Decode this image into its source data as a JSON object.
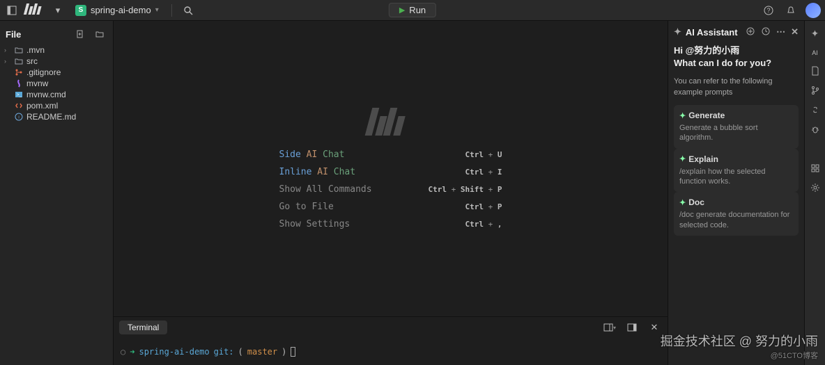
{
  "topbar": {
    "project_icon_letter": "S",
    "project_name": "spring-ai-demo",
    "run_label": "Run"
  },
  "file_panel": {
    "title": "File",
    "nodes": [
      {
        "icon": "folder",
        "label": ".mvn",
        "expandable": true
      },
      {
        "icon": "folder",
        "label": "src",
        "expandable": true
      },
      {
        "icon": "git",
        "label": ".gitignore",
        "expandable": false
      },
      {
        "icon": "mvn",
        "label": "mvnw",
        "expandable": false
      },
      {
        "icon": "cmd",
        "label": "mvnw.cmd",
        "expandable": false
      },
      {
        "icon": "xml",
        "label": "pom.xml",
        "expandable": false
      },
      {
        "icon": "md",
        "label": "README.md",
        "expandable": false
      }
    ]
  },
  "shortcuts": {
    "rows": [
      {
        "label_html": "<span class='w1'>Side</span> <span class='w2'>AI</span> <span class='w3'>Chat</span>",
        "keys": "Ctrl + U"
      },
      {
        "label_html": "<span class='w1'>Inline</span> <span class='w2'>AI</span> <span class='w3'>Chat</span>",
        "keys": "Ctrl + I"
      },
      {
        "label_html": "Show All Commands",
        "keys": "Ctrl + Shift + P"
      },
      {
        "label_html": "Go to File",
        "keys": "Ctrl + P"
      },
      {
        "label_html": "Show Settings",
        "keys": "Ctrl + ,"
      }
    ]
  },
  "terminal": {
    "tab_label": "Terminal",
    "prompt_path": "spring-ai-demo",
    "prompt_git": "git:",
    "prompt_branch": "master"
  },
  "ai": {
    "title": "AI Assistant",
    "greeting_line1": "Hi @努力的小雨",
    "greeting_line2": "What can I do for you?",
    "subtext": "You can refer to the following example prompts",
    "cards": [
      {
        "title": "Generate",
        "desc": "Generate a bubble sort algorithm."
      },
      {
        "title": "Explain",
        "desc": "/explain how the selected function works."
      },
      {
        "title": "Doc",
        "desc": "/doc generate documentation for selected code."
      }
    ]
  },
  "rail": {
    "ai_label": "AI"
  },
  "watermark": {
    "main": "掘金技术社区 @ 努力的小雨",
    "sub": "@51CTO博客"
  }
}
